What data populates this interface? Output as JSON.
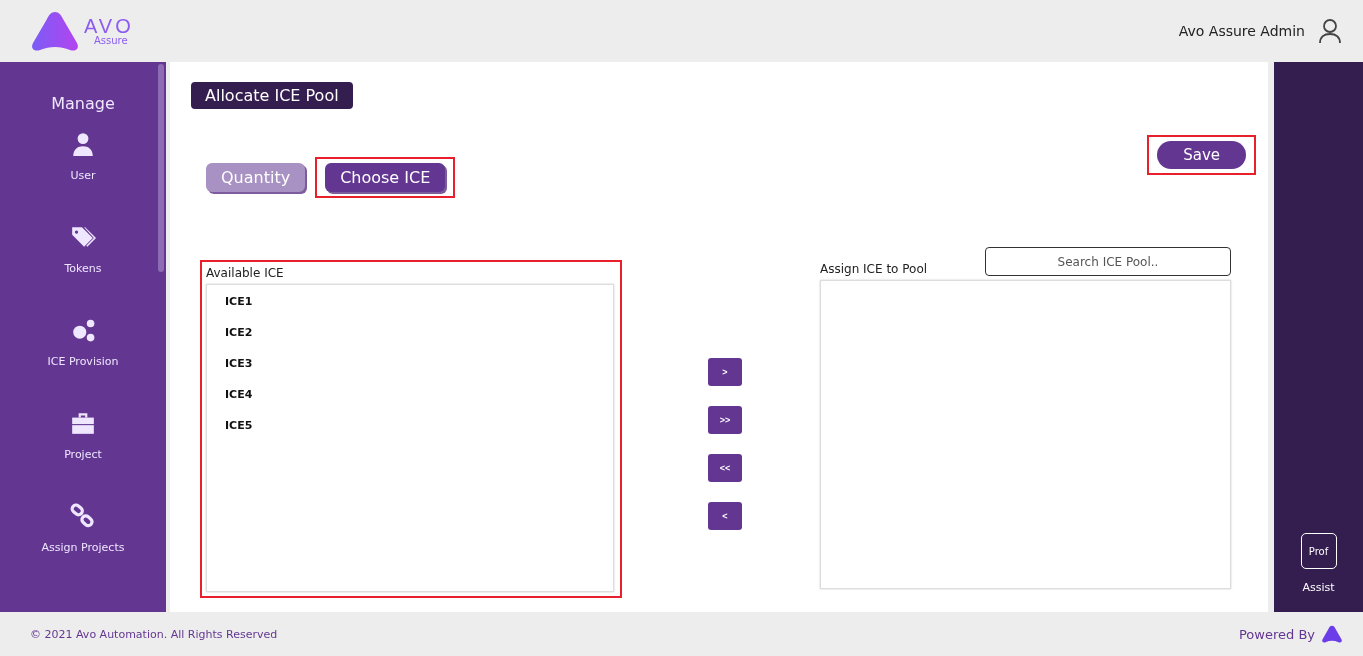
{
  "header": {
    "logo_text": "AVO",
    "logo_sub": "Assure",
    "user_name": "Avo Assure Admin"
  },
  "sidebar": {
    "title": "Manage",
    "items": [
      {
        "label": "User"
      },
      {
        "label": "Tokens"
      },
      {
        "label": "ICE Provision"
      },
      {
        "label": "Project"
      },
      {
        "label": "Assign Projects"
      }
    ]
  },
  "page_title": "Allocate ICE Pool",
  "tabs": [
    {
      "label": "Quantity",
      "selected": false
    },
    {
      "label": "Choose ICE",
      "selected": true
    }
  ],
  "save_button": "Save",
  "available": {
    "label": "Available ICE",
    "items": [
      "ICE1",
      "ICE2",
      "ICE3",
      "ICE4",
      "ICE5"
    ]
  },
  "move_buttons": [
    ">",
    ">>",
    "<<",
    "<"
  ],
  "assigned": {
    "label": "Assign ICE to Pool",
    "search_placeholder": "Search ICE Pool.."
  },
  "assist": {
    "icon_text": "Prof",
    "label": "Assist"
  },
  "footer": {
    "copyright": "© 2021 Avo Automation. All Rights Reserved",
    "powered_by": "Powered By"
  }
}
